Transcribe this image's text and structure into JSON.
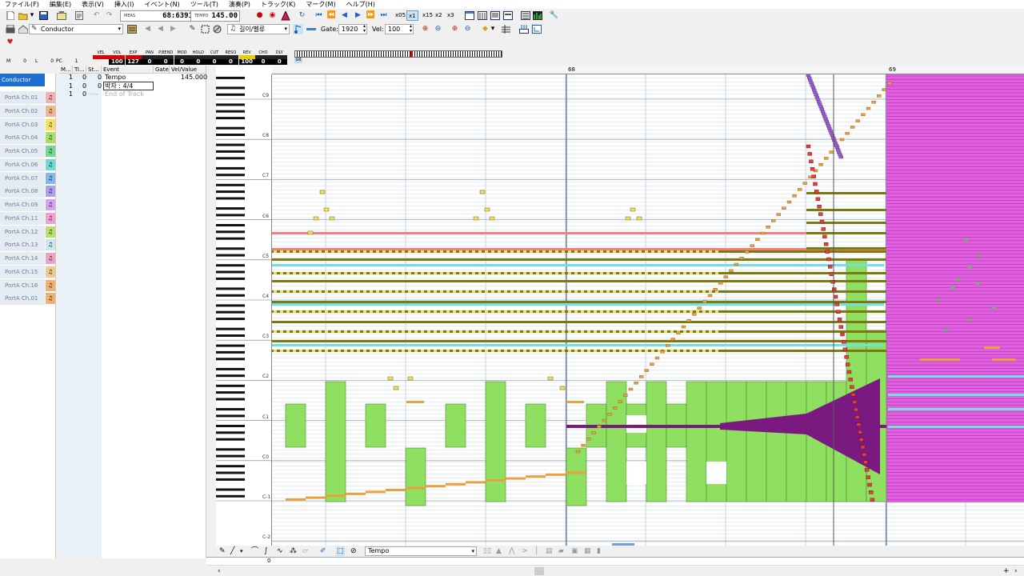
{
  "menu": [
    "ファイル(F)",
    "編集(E)",
    "表示(V)",
    "挿入(I)",
    "イベント(N)",
    "ツール(T)",
    "演奏(P)",
    "トラック(K)",
    "マーク(M)",
    "ヘルプ(H)"
  ],
  "transport": {
    "meas_label": "MEAS",
    "meas_value": "68:6391",
    "tempo_label": "TEMPO",
    "tempo_value": "145.00",
    "speeds": [
      "x05",
      "x1",
      "x15",
      "x2",
      "x3"
    ],
    "active_speed": "x1"
  },
  "row2": {
    "track_combo": "Conductor",
    "tool_combo": "길이/벨류",
    "gate_label": "Gate:",
    "gate_value": "1920",
    "vel_label": "Vel:",
    "vel_value": "100"
  },
  "mixer": {
    "mini": [
      {
        "k": "M",
        "v": "0"
      },
      {
        "k": "L",
        "v": "0"
      },
      {
        "k": "PC",
        "v": "1"
      }
    ],
    "cols": [
      {
        "label": "VEL",
        "value": "",
        "color": "#e00000"
      },
      {
        "label": "VOL",
        "value": "100",
        "color": "#e00000"
      },
      {
        "label": "EXP",
        "value": "127",
        "color": "#e00000"
      },
      {
        "label": "PAN",
        "value": "0",
        "color": "#222222"
      },
      {
        "label": "P.BEND",
        "value": "0",
        "color": "#222222"
      },
      {
        "label": "MOD",
        "value": "0",
        "color": "#222222"
      },
      {
        "label": "HOLD",
        "value": "0",
        "color": "#222222"
      },
      {
        "label": "CUT",
        "value": "0",
        "color": "#222222"
      },
      {
        "label": "RESO",
        "value": "0",
        "color": "#222222"
      },
      {
        "label": "REV",
        "value": "100",
        "color": "#e8d000"
      },
      {
        "label": "CHO",
        "value": "0",
        "color": "#222222"
      },
      {
        "label": "DLY",
        "value": "0",
        "color": "#222222"
      }
    ],
    "kbd_num": "G6"
  },
  "tracks": [
    {
      "name": "Conductor",
      "color": "",
      "selected": true
    },
    {
      "name": "PortA Ch.01",
      "color": "#f2b0b0"
    },
    {
      "name": "PortA Ch.02",
      "color": "#f2b58a"
    },
    {
      "name": "PortA Ch.03",
      "color": "#f5e060"
    },
    {
      "name": "PortA Ch.04",
      "color": "#a6e060"
    },
    {
      "name": "PortA Ch.05",
      "color": "#70d890"
    },
    {
      "name": "PortA Ch.06",
      "color": "#70d8d0"
    },
    {
      "name": "PortA Ch.07",
      "color": "#80b8f0"
    },
    {
      "name": "PortA Ch.08",
      "color": "#a8a0f0"
    },
    {
      "name": "PortA Ch.09",
      "color": "#d8a0f0"
    },
    {
      "name": "PortA Ch.11",
      "color": "#f0a0d0"
    },
    {
      "name": "PortA Ch.12",
      "color": "#b8e070"
    },
    {
      "name": "PortA Ch.13",
      "color": "#c8e8f0"
    },
    {
      "name": "PortA Ch.14",
      "color": "#f0a0c0"
    },
    {
      "name": "PortA Ch.15",
      "color": "#f0c890"
    },
    {
      "name": "PortA Ch.16",
      "color": "#f0b070"
    },
    {
      "name": "PortA Ch.01",
      "color": "#f0b070"
    }
  ],
  "events": {
    "headers": [
      "M...",
      "Ti...",
      "St...",
      "Event",
      "Gate",
      "Vel/Value"
    ],
    "rows": [
      {
        "m": "1",
        "ti": "0",
        "st": "0",
        "event": "Tempo",
        "gate": "",
        "value": "145.000",
        "grey": false
      },
      {
        "m": "1",
        "ti": "0",
        "st": "0",
        "event": "박자 : 4/4",
        "gate": "",
        "value": "",
        "grey": false
      },
      {
        "m": "1",
        "ti": "0",
        "st": "----",
        "event": "End of Track",
        "gate": "",
        "value": "",
        "grey": true
      }
    ]
  },
  "roll": {
    "measures": [
      "68",
      "69"
    ],
    "octaves": [
      "C9",
      "C8",
      "C7",
      "C6",
      "C5",
      "C4",
      "C3",
      "C2",
      "C1",
      "C0",
      "C-1",
      "C-2"
    ]
  },
  "bottom": {
    "controller_combo": "Tempo",
    "ctl_value": "0"
  },
  "colors": {
    "note_green": "#8fe060",
    "note_olive": "#7a7a10",
    "note_yellow": "#f0e060",
    "note_cyan": "#70e0e0",
    "note_red": "#f08080",
    "note_orange": "#e8a040",
    "note_purple": "#7a1a80",
    "note_magenta": "#e060e0"
  }
}
